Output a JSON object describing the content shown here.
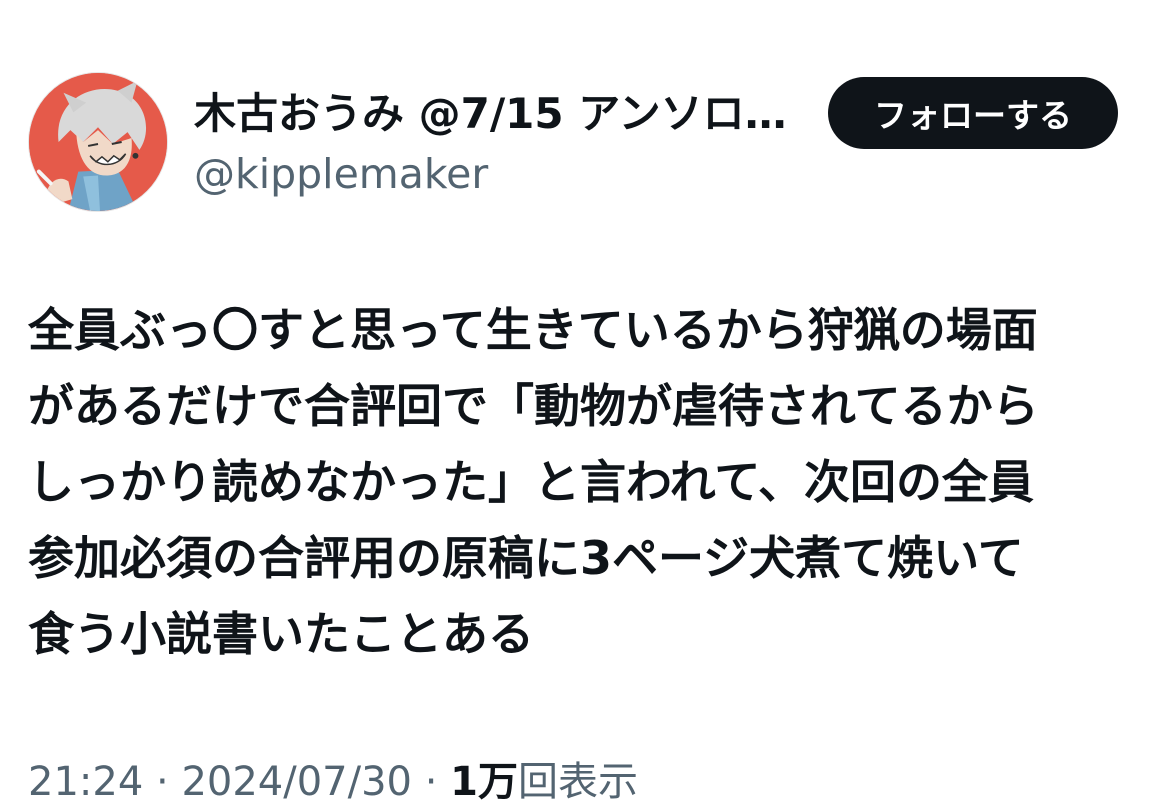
{
  "user": {
    "display_name": "木古おうみ @7/15 アンソロ…",
    "handle": "@kipplemaker"
  },
  "follow_button": {
    "label": "フォローする"
  },
  "tweet": {
    "lines": [
      "全員ぶっ〇すと思って生きているから狩猟の場面",
      "があるだけで合評回で「動物が虐待されてるから",
      "しっかり読めなかった」と言われて、次回の全員",
      "参加必須の合評用の原稿に3ページ犬煮て焼いて",
      "食う小説書いたことある"
    ]
  },
  "meta": {
    "time": "21:24",
    "separator_1": " · ",
    "date": "2024/07/30",
    "separator_2": " · ",
    "views_count": "1万",
    "views_label": "回表示"
  },
  "colors": {
    "text": "#0f1419",
    "secondary": "#536471",
    "button_bg": "#0f1419",
    "avatar_bg": "#e55a4a"
  },
  "icons": {
    "avatar": "user-avatar-illustration"
  }
}
